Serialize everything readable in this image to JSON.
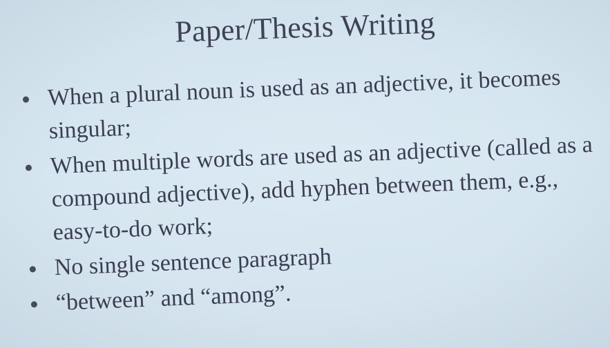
{
  "slide": {
    "title": "Paper/Thesis Writing",
    "bullets": [
      "When a plural noun is used as an adjective, it becomes singular;",
      "When multiple words are used as an adjective (called as a compound adjective), add hyphen between them, e.g., easy-to-do work;",
      "No single sentence paragraph",
      "“between” and “among”."
    ]
  },
  "colors": {
    "background": "#d6e6f0",
    "text": "#3c3f52"
  }
}
